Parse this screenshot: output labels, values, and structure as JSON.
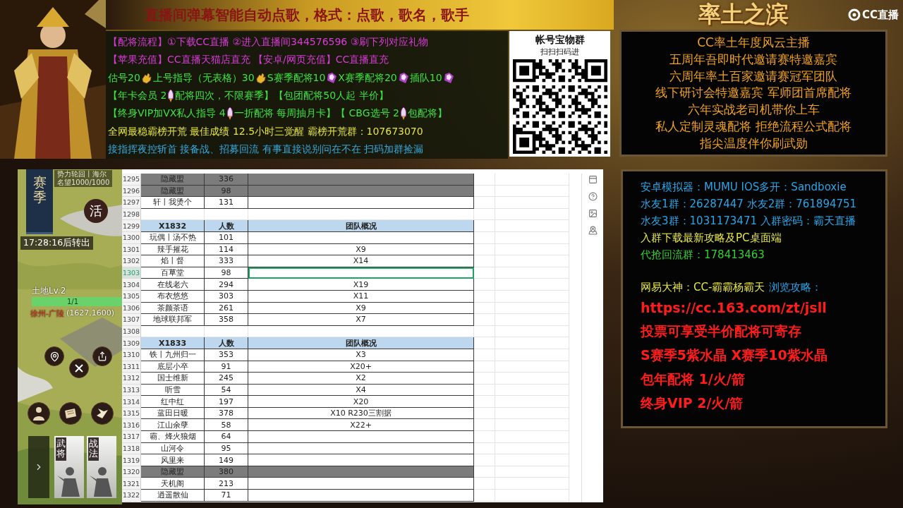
{
  "title": "直播间弹幕智能自动点歌，格式：点歌，歌名，歌手",
  "promo": {
    "lines": [
      {
        "color": "#d93ad9",
        "parts": [
          {
            "kind": "text",
            "text": "【配将流程】①下载CC直播 ②进入直播间344576596 ③刷下列对应礼物"
          }
        ]
      },
      {
        "color": "#d93ad9",
        "parts": [
          {
            "kind": "text",
            "text": "【苹果充值】CC直播天猫店直充 【安卓/网页充值】CC直播直充"
          }
        ]
      },
      {
        "color": "#3ee33e",
        "parts": [
          {
            "kind": "text",
            "text": "估号20"
          },
          {
            "kind": "hand"
          },
          {
            "kind": "text",
            "text": "上号指导（无表格）30"
          },
          {
            "kind": "hand"
          },
          {
            "kind": "text",
            "text": "S赛季配将10"
          },
          {
            "kind": "crystal"
          },
          {
            "kind": "text",
            "text": "X赛季配将20"
          },
          {
            "kind": "crystal"
          },
          {
            "kind": "text",
            "text": "插队10"
          },
          {
            "kind": "crystal"
          }
        ]
      },
      {
        "color": "#3ee33e",
        "parts": [
          {
            "kind": "text",
            "text": "【年卡会员 2"
          },
          {
            "kind": "rocket"
          },
          {
            "kind": "text",
            "text": " 配将四次，不限赛季】【包团配将50人起 半价】"
          }
        ]
      },
      {
        "color": "#3ee33e",
        "parts": [
          {
            "kind": "text",
            "text": "【终身VIP加VX私人指导 4"
          },
          {
            "kind": "rocket"
          },
          {
            "kind": "text",
            "text": " 一折配将 每周抽月卡】【 CBG选号 2"
          },
          {
            "kind": "rocket"
          },
          {
            "kind": "text",
            "text": "包配将】"
          }
        ]
      },
      {
        "color": "#e4e43e",
        "parts": [
          {
            "kind": "text",
            "text": "全网最稳霸榜开荒 最佳成绩 12.5小时三觉醒 霸榜开荒群：107673070"
          }
        ]
      },
      {
        "color": "#36a8dc",
        "parts": [
          {
            "kind": "text",
            "text": "接指挥夜控斩首 接备战、招募回流   有事直接说别问在不在 扫码加群捡漏"
          }
        ]
      }
    ]
  },
  "qr_card": {
    "title": "帐号宝物群",
    "subtitle": "扫扫扫码进"
  },
  "logo": {
    "game_title": "率土之滨",
    "platform": "CC直播"
  },
  "honors": [
    "CC率土年度风云主播",
    "五周年吾即时代邀请赛特邀嘉宾",
    "六周年率土百家邀请赛冠军团队",
    "线下研讨会特邀嘉宾 军师团首席配将",
    "六年实战老司机带你上车",
    "私人定制灵魂配将 拒绝流程公式配将",
    "指尖温度伴你刷武勋"
  ],
  "info_panel": {
    "sections": [
      {
        "lines": [
          {
            "kind": "normal",
            "segments": [
              {
                "text": "安卓模拟器：MUMU IOS多开：Sandboxie",
                "color": "#2aa6e8"
              }
            ]
          },
          {
            "kind": "normal",
            "segments": [
              {
                "text": "水友1群：26287447 水友2群：761894751",
                "color": "#2aa6e8"
              }
            ]
          },
          {
            "kind": "normal",
            "segments": [
              {
                "text": "水友3群：1031173471 入群密码：霸天直播",
                "color": "#2aa6e8"
              }
            ]
          },
          {
            "kind": "normal",
            "segments": [
              {
                "text": "入群下载最新攻略及PC桌面端",
                "color": "#e6e64a"
              }
            ]
          },
          {
            "kind": "normal",
            "segments": [
              {
                "text": "代抢回流群：178413463",
                "color": "#33d033"
              }
            ]
          }
        ]
      },
      {
        "lines": [
          {
            "kind": "normal",
            "segments": [
              {
                "text": "网易大神：CC-霸霸杨霸天",
                "color": "#e6e64a"
              },
              {
                "text": "浏览攻略：",
                "color": "#2aa6e8"
              }
            ]
          },
          {
            "kind": "big",
            "segments": [
              {
                "text": "https://cc.163.com/zt/jsll",
                "color": "#ff1c1c"
              }
            ]
          },
          {
            "kind": "big",
            "segments": [
              {
                "text": "投票可享受半价配将可寄存",
                "color": "#ff1c1c"
              }
            ]
          },
          {
            "kind": "big",
            "segments": [
              {
                "text": "S赛季5紫水晶 X赛季10紫水晶",
                "color": "#ff1c1c"
              }
            ]
          },
          {
            "kind": "big",
            "segments": [
              {
                "text": "包年配将 1/火/箭",
                "color": "#ff1c1c"
              }
            ]
          },
          {
            "kind": "big",
            "segments": [
              {
                "text": "终身VIP 2/火/箭",
                "color": "#ff1c1c"
              }
            ]
          }
        ]
      }
    ]
  },
  "game": {
    "status_lines": [
      "势力轮回丨海尔",
      "名望1000/1000"
    ],
    "season_badge": "赛季",
    "activity_button": "活",
    "countdown": "17:28:16后转出",
    "land": {
      "label": "土地Lv.2",
      "reading": "1/1",
      "level": 1,
      "location": "徐州-广陵",
      "coords": "(1627,1600)"
    },
    "cards": [
      "武将",
      "战法"
    ]
  },
  "sheet": {
    "rows": [
      {
        "number": "1295",
        "kind": "data",
        "shaded": true,
        "selected": false,
        "name": "隐藏盟",
        "count": "336"
      },
      {
        "number": "1296",
        "kind": "data",
        "shaded": true,
        "selected": false,
        "name": "隐藏盟",
        "count": "98"
      },
      {
        "number": "1297",
        "kind": "data",
        "shaded": false,
        "selected": false,
        "name": "轩丨我烫个",
        "count": "131"
      },
      {
        "number": "1298",
        "kind": "blank",
        "shaded": false,
        "selected": false
      },
      {
        "number": "1299",
        "kind": "header",
        "shaded": false,
        "selected": false,
        "name": "X1832",
        "count": "人数",
        "team": "团队概况"
      },
      {
        "number": "1300",
        "kind": "data",
        "shaded": false,
        "selected": false,
        "name": "玩偶丨汤不热",
        "count": "101"
      },
      {
        "number": "1301",
        "kind": "data",
        "shaded": false,
        "selected": false,
        "name": "辣手摧花",
        "count": "114",
        "team": "X9"
      },
      {
        "number": "1302",
        "kind": "data",
        "shaded": false,
        "selected": false,
        "name": "焰丨督",
        "count": "333",
        "team": "X14"
      },
      {
        "number": "1303",
        "kind": "data",
        "shaded": false,
        "selected": true,
        "name": "百草堂",
        "count": "98"
      },
      {
        "number": "1304",
        "kind": "data",
        "shaded": false,
        "selected": false,
        "name": "在线老六",
        "count": "294",
        "team": "X19"
      },
      {
        "number": "1305",
        "kind": "data",
        "shaded": false,
        "selected": false,
        "name": "布衣悠悠",
        "count": "303",
        "team": "X11"
      },
      {
        "number": "1306",
        "kind": "data",
        "shaded": false,
        "selected": false,
        "name": "茶颜茶语",
        "count": "261",
        "team": "X9"
      },
      {
        "number": "1307",
        "kind": "data",
        "shaded": false,
        "selected": false,
        "name": "地球联邦军",
        "count": "358",
        "team": "X7"
      },
      {
        "number": "1308",
        "kind": "blank",
        "shaded": false,
        "selected": false
      },
      {
        "number": "1309",
        "kind": "header",
        "shaded": false,
        "selected": false,
        "name": "X1833",
        "count": "人数",
        "team": "团队概况"
      },
      {
        "number": "1310",
        "kind": "data",
        "shaded": false,
        "selected": false,
        "name": "铁丨九州归一",
        "count": "353",
        "team": "X3"
      },
      {
        "number": "1311",
        "kind": "data",
        "shaded": false,
        "selected": false,
        "name": "底层小卒",
        "count": "91",
        "team": "X20+"
      },
      {
        "number": "1312",
        "kind": "data",
        "shaded": false,
        "selected": false,
        "name": "国士维新",
        "count": "245",
        "team": "X2"
      },
      {
        "number": "1313",
        "kind": "data",
        "shaded": false,
        "selected": false,
        "name": "听雪",
        "count": "54",
        "team": "X4"
      },
      {
        "number": "1314",
        "kind": "data",
        "shaded": false,
        "selected": false,
        "name": "红中红",
        "count": "197",
        "team": "X20"
      },
      {
        "number": "1315",
        "kind": "data",
        "shaded": false,
        "selected": false,
        "name": "蓝田日暖",
        "count": "378",
        "team": "X10 R230三割据"
      },
      {
        "number": "1316",
        "kind": "data",
        "shaded": false,
        "selected": false,
        "name": "江山余孽",
        "count": "58",
        "team": "X22+"
      },
      {
        "number": "1317",
        "kind": "data",
        "shaded": false,
        "selected": false,
        "name": "霸、烽火狼烟",
        "count": "64"
      },
      {
        "number": "1318",
        "kind": "data",
        "shaded": false,
        "selected": false,
        "name": "山河令",
        "count": "95"
      },
      {
        "number": "1319",
        "kind": "data",
        "shaded": false,
        "selected": false,
        "name": "风里来",
        "count": "149"
      },
      {
        "number": "1320",
        "kind": "data",
        "shaded": true,
        "selected": false,
        "name": "隐藏盟",
        "count": "380"
      },
      {
        "number": "1321",
        "kind": "data",
        "shaded": false,
        "selected": false,
        "name": "天机阁",
        "count": "213"
      },
      {
        "number": "1322",
        "kind": "data",
        "shaded": false,
        "selected": false,
        "name": "逍遥散仙",
        "count": "71"
      }
    ]
  }
}
